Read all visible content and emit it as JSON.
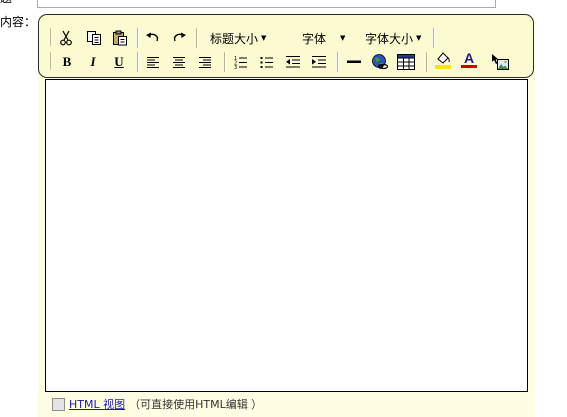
{
  "top_field": {
    "label_fragment": "题",
    "value": ""
  },
  "content_label": "内容：",
  "toolbar": {
    "row1": {
      "cut_icon": "scissors-icon",
      "copy_icon": "copy-icon",
      "paste_icon": "paste-icon",
      "undo_icon": "undo-icon",
      "redo_icon": "redo-icon",
      "heading_size": "标题大小",
      "font": "字体",
      "font_size": "字体大小"
    },
    "row2": {
      "bold": "B",
      "italic": "I",
      "underline": "U",
      "text_color_glyph": "A"
    }
  },
  "editor": {
    "content": ""
  },
  "bottom": {
    "html_view_label": "HTML 视图",
    "hint": "（可直接使用HTML编辑 ）"
  },
  "colors": {
    "panel_bg": "#fffde3",
    "toolbar_bg": "#fcfad0",
    "toolbar_border": "#2b2b2b",
    "link": "#1a1aa6",
    "highlight_yellow": "#f5e800",
    "text_color_underline": "#cc0000"
  }
}
